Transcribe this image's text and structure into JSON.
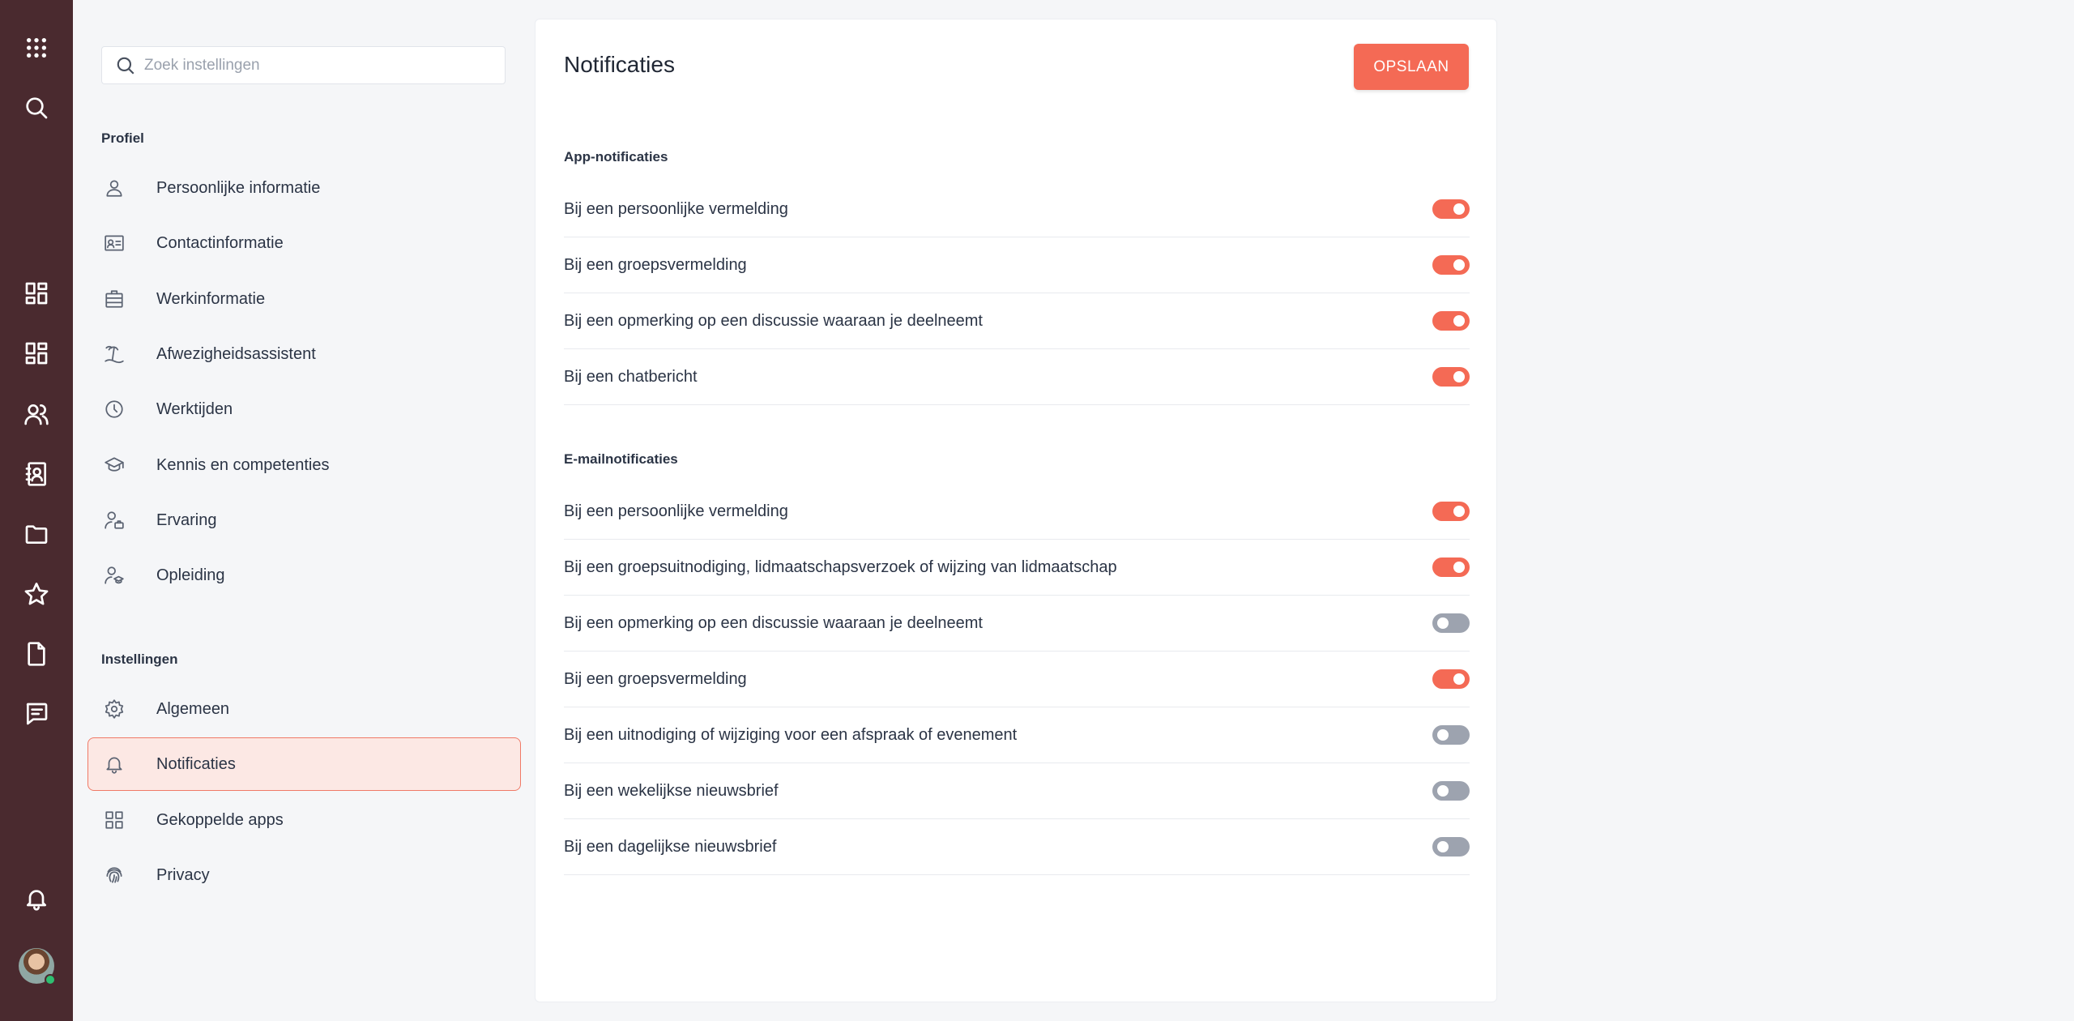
{
  "search": {
    "placeholder": "Zoek instellingen"
  },
  "nav": {
    "profile_title": "Profiel",
    "profile_items": [
      {
        "label": "Persoonlijke informatie",
        "icon": "person-icon"
      },
      {
        "label": "Contactinformatie",
        "icon": "contact-card-icon"
      },
      {
        "label": "Werkinformatie",
        "icon": "briefcase-icon"
      },
      {
        "label": "Afwezigheidsassistent",
        "icon": "beach-icon"
      },
      {
        "label": "Werktijden",
        "icon": "clock-icon"
      },
      {
        "label": "Kennis en competenties",
        "icon": "graduation-cap-icon"
      },
      {
        "label": "Ervaring",
        "icon": "person-briefcase-icon"
      },
      {
        "label": "Opleiding",
        "icon": "person-graduation-icon"
      }
    ],
    "settings_title": "Instellingen",
    "settings_items": [
      {
        "label": "Algemeen",
        "icon": "gear-icon"
      },
      {
        "label": "Notificaties",
        "icon": "bell-icon",
        "active": true
      },
      {
        "label": "Gekoppelde apps",
        "icon": "apps-grid-icon"
      },
      {
        "label": "Privacy",
        "icon": "fingerprint-icon"
      }
    ]
  },
  "main": {
    "title": "Notificaties",
    "save_label": "OPSLAAN",
    "app_title": "App-notificaties",
    "app_items": [
      {
        "label": "Bij een persoonlijke vermelding",
        "on": true
      },
      {
        "label": "Bij een groepsvermelding",
        "on": true
      },
      {
        "label": "Bij een opmerking op een discussie waaraan je deelneemt",
        "on": true
      },
      {
        "label": "Bij een chatbericht",
        "on": true
      }
    ],
    "email_title": "E-mailnotificaties",
    "email_items": [
      {
        "label": "Bij een persoonlijke vermelding",
        "on": true
      },
      {
        "label": "Bij een groepsuitnodiging, lidmaatschapsverzoek of wijzing van lidmaatschap",
        "on": true
      },
      {
        "label": "Bij een opmerking op een discussie waaraan je deelneemt",
        "on": false
      },
      {
        "label": "Bij een groepsvermelding",
        "on": true
      },
      {
        "label": "Bij een uitnodiging of wijziging voor een afspraak of evenement",
        "on": false
      },
      {
        "label": "Bij een wekelijkse nieuwsbrief",
        "on": false
      },
      {
        "label": "Bij een dagelijkse nieuwsbrief",
        "on": false
      }
    ]
  },
  "colors": {
    "rail": "#4a2a2f",
    "accent": "#f46a55",
    "toggle_off": "#9da3af",
    "active_bg": "#fce8e4"
  },
  "rail_icons": [
    "apps-grid-icon",
    "search-icon",
    "dashboard-icon",
    "dashboard-alt-icon",
    "people-icon",
    "address-book-icon",
    "folder-icon",
    "star-icon",
    "document-icon",
    "message-icon",
    "bell-icon",
    "avatar"
  ]
}
